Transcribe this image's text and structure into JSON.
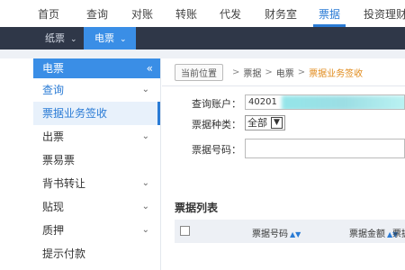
{
  "topnav": {
    "items": [
      "首页",
      "查询",
      "对账",
      "转账",
      "代发",
      "财务室",
      "票据",
      "投资理财"
    ],
    "active_index": 6
  },
  "subnav": {
    "items": [
      {
        "label": "纸票",
        "chevron": "chevron-down-icon"
      },
      {
        "label": "电票",
        "chevron": "chevron-down-icon"
      }
    ],
    "active_index": 1
  },
  "sidebar": {
    "title": "电票",
    "collapse_glyph": "«",
    "items": [
      {
        "label": "查询",
        "has_chevron": true
      },
      {
        "label": "票据业务签收",
        "has_chevron": false,
        "active": true
      },
      {
        "label": "出票",
        "has_chevron": true
      },
      {
        "label": "票易票",
        "has_chevron": false
      },
      {
        "label": "背书转让",
        "has_chevron": true
      },
      {
        "label": "贴现",
        "has_chevron": true
      },
      {
        "label": "质押",
        "has_chevron": true
      },
      {
        "label": "提示付款",
        "has_chevron": false
      }
    ]
  },
  "breadcrumb": {
    "current_label": "当前位置",
    "path": [
      "票据",
      "电票",
      "票据业务签收"
    ],
    "separator": ">"
  },
  "form": {
    "account_label": "查询账户：",
    "account_value": "40201",
    "type_label": "票据种类：",
    "type_value": "全部",
    "number_label": "票据号码："
  },
  "list": {
    "title": "票据列表",
    "columns": [
      "票据号码",
      "票据金额",
      "票据"
    ]
  },
  "colors": {
    "accent": "#2a7bd5",
    "subnav_bg": "#2f3748",
    "breadcrumb_active": "#e08a1a"
  }
}
